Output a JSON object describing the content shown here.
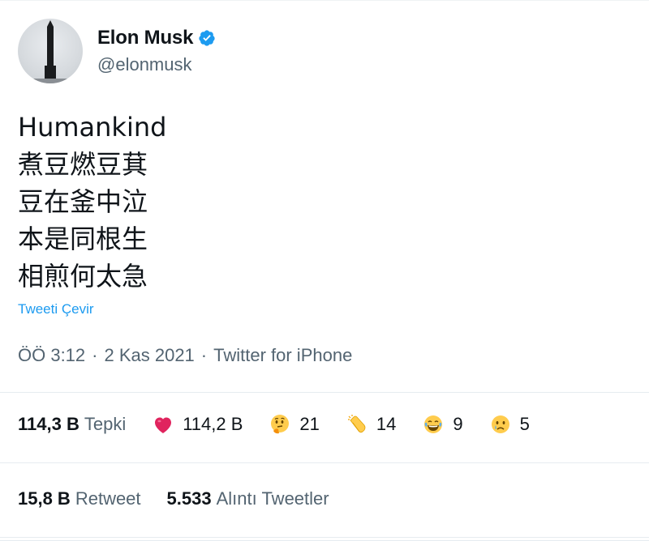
{
  "user": {
    "display_name": "Elon Musk",
    "handle": "@elonmusk",
    "verified": true,
    "avatar_icon": "rocket-avatar-icon"
  },
  "tweet": {
    "lines": [
      "Humankind",
      "煮豆燃豆萁",
      "豆在釜中泣",
      "本是同根生",
      "相煎何太急"
    ],
    "translate_label": "Tweeti Çevir",
    "time": "ÖÖ 3:12",
    "separator": "·",
    "date": "2 Kas 2021",
    "source": "Twitter for iPhone"
  },
  "reactions": {
    "total_count": "114,3 B",
    "total_label": "Tepki",
    "items": [
      {
        "icon": "heart-icon",
        "count": "114,2 B"
      },
      {
        "icon": "thinking-face-icon",
        "count": "21"
      },
      {
        "icon": "clapping-hands-icon",
        "count": "14"
      },
      {
        "icon": "laughing-face-icon",
        "count": "9"
      },
      {
        "icon": "crying-face-icon",
        "count": "5"
      }
    ]
  },
  "stats": {
    "retweet_count": "15,8 B",
    "retweet_label": "Retweet",
    "quote_count": "5.533",
    "quote_label": "Alıntı Tweetler"
  },
  "colors": {
    "text_primary": "#0f1419",
    "text_secondary": "#536471",
    "accent": "#1d9bf0",
    "divider": "#e6ecf0",
    "heart": "#e0245e",
    "emoji_yellow": "#ffcc4d"
  }
}
